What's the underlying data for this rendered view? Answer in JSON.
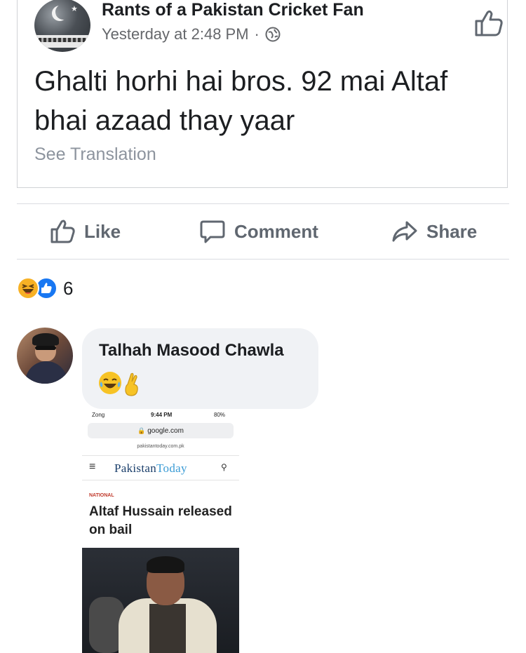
{
  "post": {
    "page_name": "Rants of a Pakistan Cricket Fan",
    "timestamp": "Yesterday at 2:48 PM",
    "separator": "·",
    "privacy_icon": "globe-icon",
    "text": "Ghalti horhi hai bros. 92 mai Altaf bhai azaad thay yaar",
    "see_translation": "See Translation"
  },
  "actions": {
    "like": "Like",
    "comment": "Comment",
    "share": "Share"
  },
  "reactions": {
    "types": [
      "haha",
      "like"
    ],
    "count": "6"
  },
  "comment": {
    "author": "Talhah Masood Chawla",
    "emojis": [
      "face-with-tears-of-joy",
      "crossed-fingers"
    ],
    "attachment": {
      "carrier": "Zong",
      "time": "9:44 PM",
      "battery": "80%",
      "address": "google.com",
      "site": "pakistantoday.com.pk",
      "brand_part1": "Pakistan",
      "brand_part2": "Today",
      "category": "NATIONAL",
      "headline": "Altaf Hussain released on bail"
    }
  },
  "colors": {
    "facebook_blue": "#1877f2",
    "haha_yellow": "#f7b125",
    "text_primary": "#1c1e21",
    "text_secondary": "#65676b",
    "action_gray": "#606770",
    "bubble_bg": "#f0f2f5"
  }
}
